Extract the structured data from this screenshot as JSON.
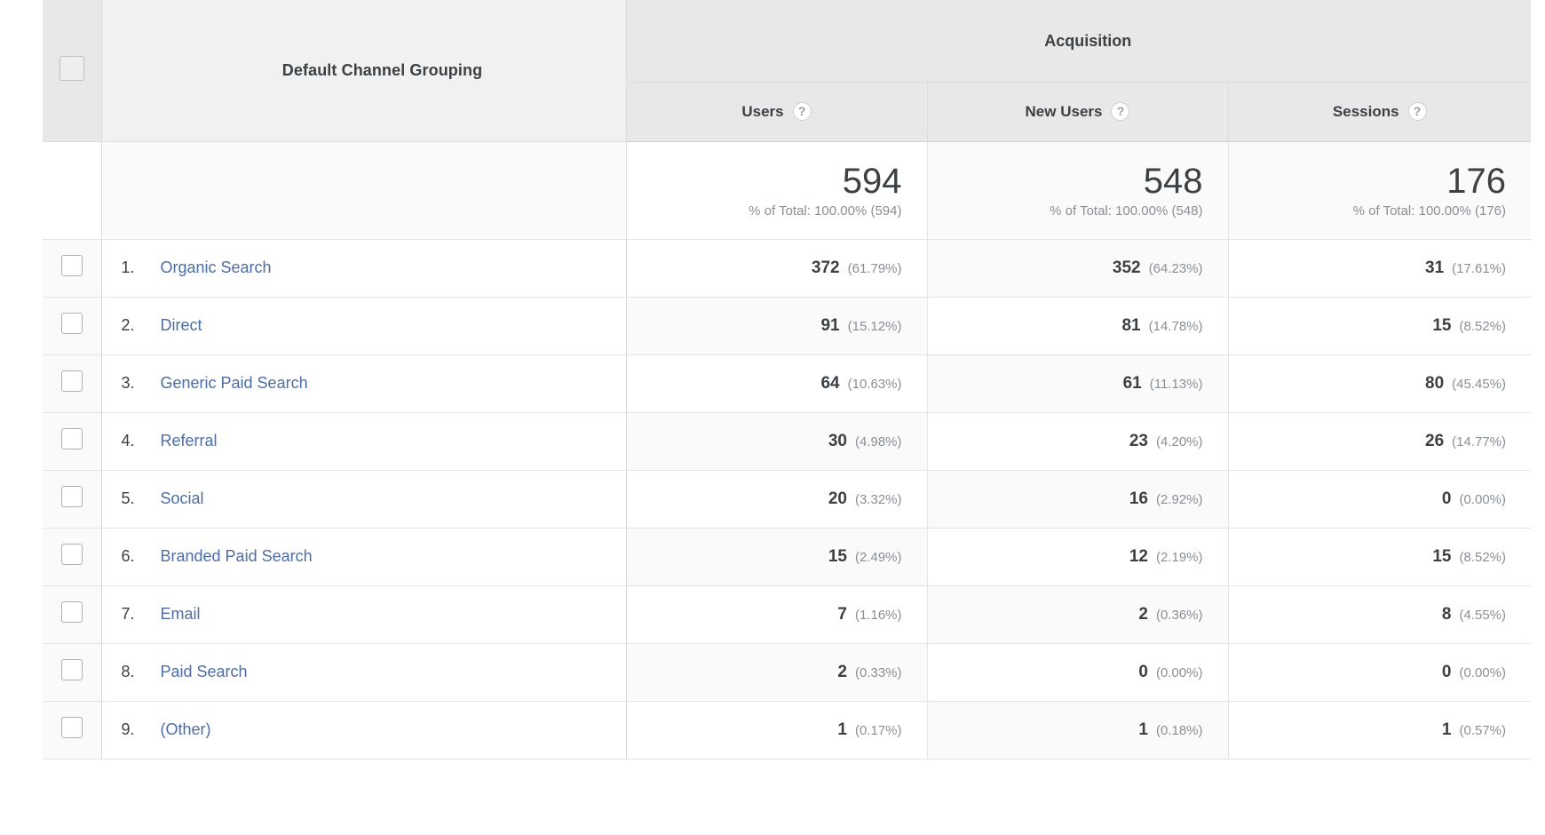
{
  "table": {
    "group_header": "Acquisition",
    "dimension_header": "Default Channel Grouping",
    "help_icon_glyph": "?",
    "sort_arrow_glyph": "↓",
    "columns": [
      {
        "label": "Users",
        "help": "?",
        "sorted": true
      },
      {
        "label": "New Users",
        "help": "?",
        "sorted": false
      },
      {
        "label": "Sessions",
        "help": "?",
        "sorted": false
      }
    ],
    "totals": [
      {
        "value": "594",
        "subtext": "% of Total: 100.00% (594)"
      },
      {
        "value": "548",
        "subtext": "% of Total: 100.00% (548)"
      },
      {
        "value": "176",
        "subtext": "% of Total: 100.00% (176)"
      }
    ],
    "rows": [
      {
        "index": "1.",
        "name": "Organic Search",
        "users": "372",
        "users_pct": "(61.79%)",
        "new_users": "352",
        "new_users_pct": "(64.23%)",
        "sessions": "31",
        "sessions_pct": "(17.61%)"
      },
      {
        "index": "2.",
        "name": "Direct",
        "users": "91",
        "users_pct": "(15.12%)",
        "new_users": "81",
        "new_users_pct": "(14.78%)",
        "sessions": "15",
        "sessions_pct": "(8.52%)"
      },
      {
        "index": "3.",
        "name": "Generic Paid Search",
        "users": "64",
        "users_pct": "(10.63%)",
        "new_users": "61",
        "new_users_pct": "(11.13%)",
        "sessions": "80",
        "sessions_pct": "(45.45%)"
      },
      {
        "index": "4.",
        "name": "Referral",
        "users": "30",
        "users_pct": "(4.98%)",
        "new_users": "23",
        "new_users_pct": "(4.20%)",
        "sessions": "26",
        "sessions_pct": "(14.77%)"
      },
      {
        "index": "5.",
        "name": "Social",
        "users": "20",
        "users_pct": "(3.32%)",
        "new_users": "16",
        "new_users_pct": "(2.92%)",
        "sessions": "0",
        "sessions_pct": "(0.00%)"
      },
      {
        "index": "6.",
        "name": "Branded Paid Search",
        "users": "15",
        "users_pct": "(2.49%)",
        "new_users": "12",
        "new_users_pct": "(2.19%)",
        "sessions": "15",
        "sessions_pct": "(8.52%)"
      },
      {
        "index": "7.",
        "name": "Email",
        "users": "7",
        "users_pct": "(1.16%)",
        "new_users": "2",
        "new_users_pct": "(0.36%)",
        "sessions": "8",
        "sessions_pct": "(4.55%)"
      },
      {
        "index": "8.",
        "name": "Paid Search",
        "users": "2",
        "users_pct": "(0.33%)",
        "new_users": "0",
        "new_users_pct": "(0.00%)",
        "sessions": "0",
        "sessions_pct": "(0.00%)"
      },
      {
        "index": "9.",
        "name": "(Other)",
        "users": "1",
        "users_pct": "(0.17%)",
        "new_users": "1",
        "new_users_pct": "(0.18%)",
        "sessions": "1",
        "sessions_pct": "(0.57%)"
      }
    ]
  },
  "colors": {
    "link": "#4d6da3",
    "text": "#3c4043",
    "muted": "#8a8f94",
    "header_bg": "#e8e8e8",
    "alt_row_bg": "#fafafa"
  }
}
